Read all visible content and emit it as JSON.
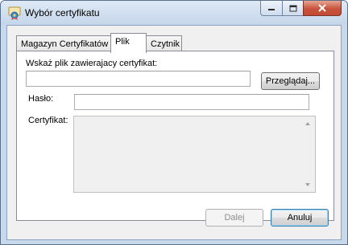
{
  "window": {
    "title": "Wybór certyfikatu"
  },
  "tabs": [
    {
      "label": "Magazyn Certyfikatów"
    },
    {
      "label": "Plik"
    },
    {
      "label": "Czytnik"
    }
  ],
  "file_tab": {
    "path_label": "Wskaż plik zawierajacy certyfikat:",
    "path_value": "",
    "browse_label": "Przeglądaj...",
    "password_label": "Hasło:",
    "password_value": "",
    "certificate_label": "Certyfikat:",
    "certificate_value": ""
  },
  "footer": {
    "next_label": "Dalej",
    "cancel_label": "Anuluj"
  }
}
